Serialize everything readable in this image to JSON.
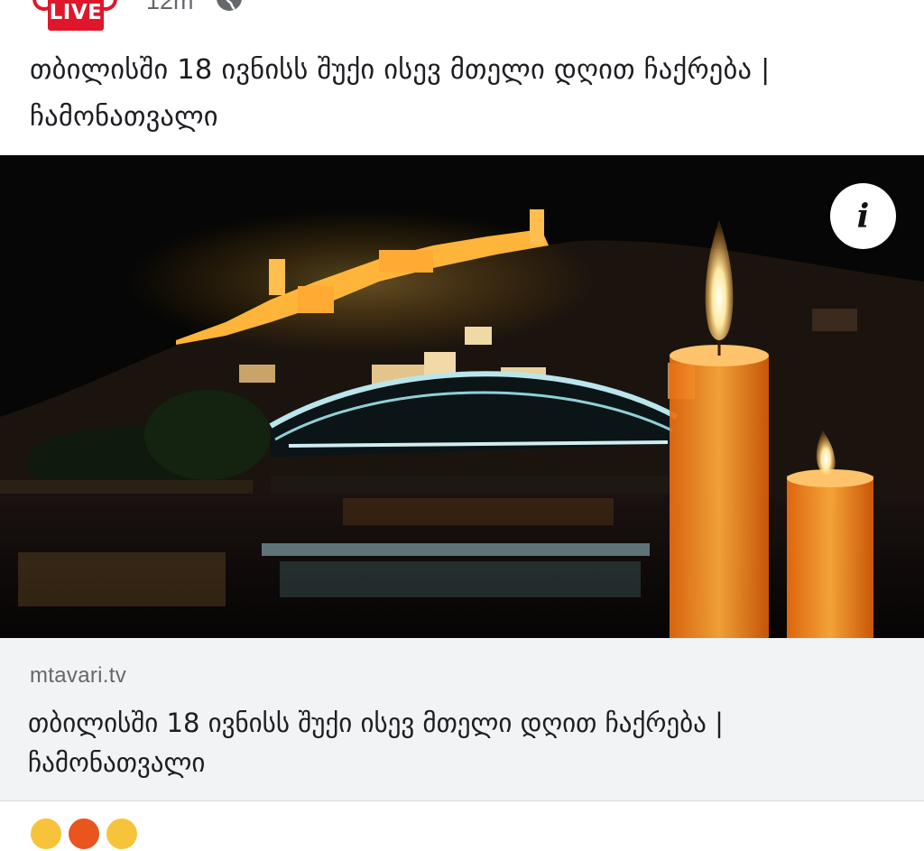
{
  "header": {
    "live_label": "LIVE",
    "time": "12m",
    "icons": [
      "live-badge",
      "globe-icon"
    ]
  },
  "post": {
    "text": "თბილისში 18 ივნისს შუქი ისევ მთელი დღით ჩაქრება | ჩამონათვალი"
  },
  "photo": {
    "info_label": "i"
  },
  "link_preview": {
    "domain": "mtavari.tv",
    "title": "თბილისში 18 ივნისს შუქი ისევ მთელი დღით ჩაქრება | ჩამონათვალი"
  },
  "reactions": {
    "icons": [
      "haha-reaction-icon",
      "angry-reaction-icon",
      "wow-reaction-icon"
    ],
    "colors": [
      "#f7c33b",
      "#e9541f",
      "#f7c33b"
    ]
  },
  "colors": {
    "live_red": "#e0162b",
    "link_background": "#f2f3f5",
    "secondary_text": "#65676b",
    "primary_text": "#1c1e21"
  }
}
